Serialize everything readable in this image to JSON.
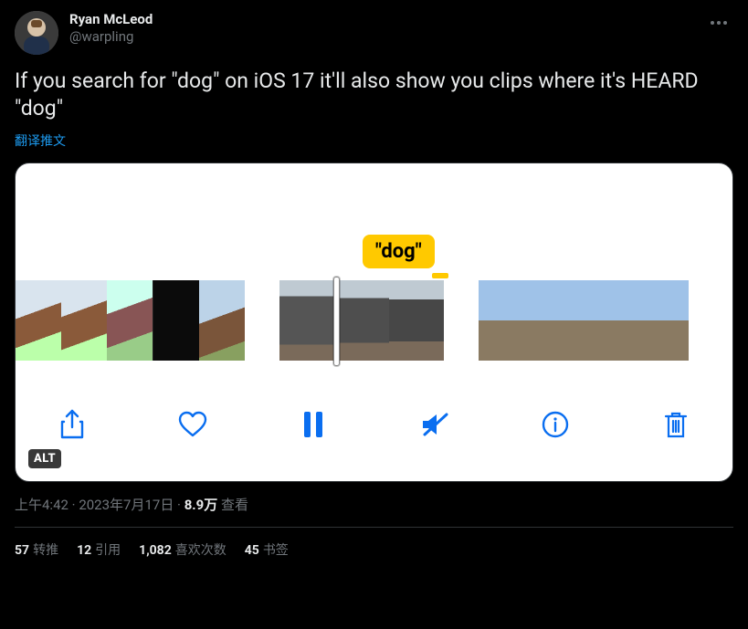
{
  "author": {
    "display_name": "Ryan McLeod",
    "handle": "@warpling"
  },
  "tweet_text": "If you search for \"dog\" on iOS 17 it'll also show you clips where it's HEARD \"dog\"",
  "translate_label": "翻译推文",
  "media": {
    "callout": "\"dog\"",
    "alt_badge": "ALT"
  },
  "meta": {
    "time": "上午4:42",
    "dot1": " · ",
    "date": "2023年7月17日",
    "dot2": " · ",
    "views_num": "8.9万",
    "views_label": " 查看"
  },
  "stats": {
    "retweets_n": "57",
    "retweets_l": "转推",
    "quotes_n": "12",
    "quotes_l": "引用",
    "likes_n": "1,082",
    "likes_l": "喜欢次数",
    "bookmarks_n": "45",
    "bookmarks_l": "书签"
  }
}
